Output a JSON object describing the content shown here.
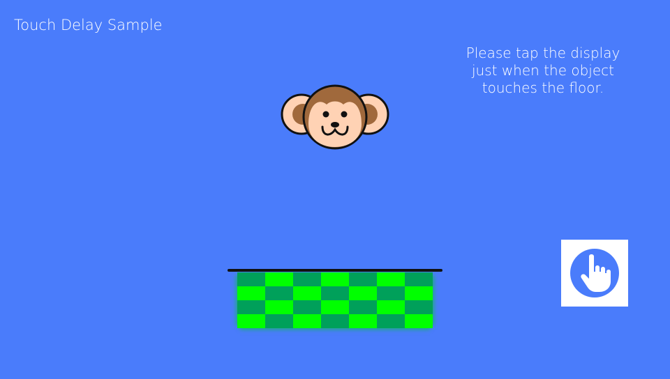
{
  "header": {
    "title": "Touch Delay Sample"
  },
  "instructions": {
    "text": "Please tap the display\njust when the object\ntouches the floor."
  },
  "game": {
    "falling_object": "monkey-face-icon",
    "floor_pattern": "green-checkerboard",
    "tap_button_icon": "hand-tap-icon"
  },
  "colors": {
    "background": "#4a7cfb",
    "floor_light": "#00ff00",
    "floor_dark": "#00a05a",
    "tap_icon": "#4a7cfb"
  }
}
